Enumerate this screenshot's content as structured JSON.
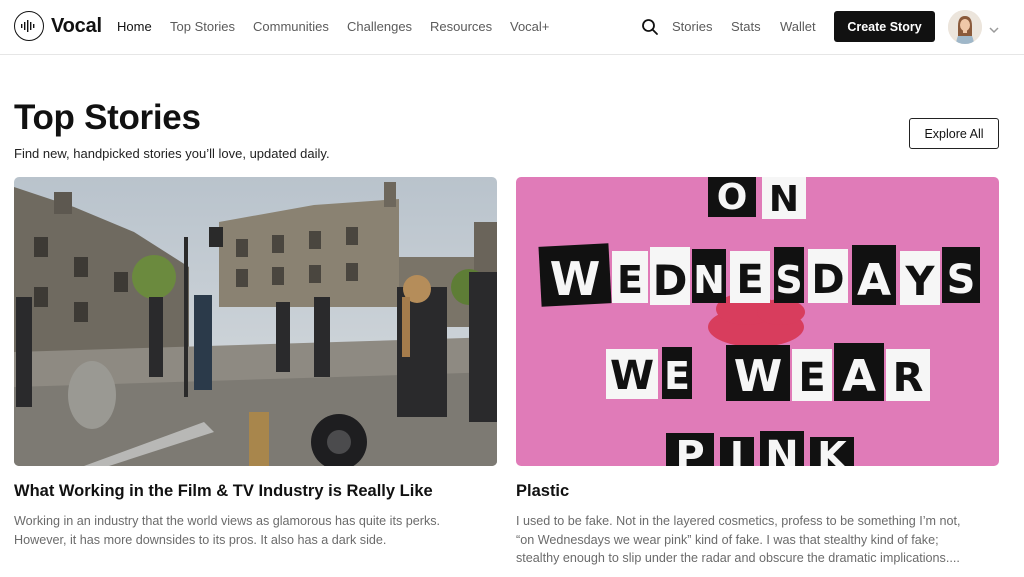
{
  "brand": {
    "name": "Vocal",
    "icon": "soundwave-circle-icon"
  },
  "nav": {
    "links": [
      {
        "label": "Home",
        "active": true
      },
      {
        "label": "Top Stories",
        "active": false
      },
      {
        "label": "Communities",
        "active": false
      },
      {
        "label": "Challenges",
        "active": false
      },
      {
        "label": "Resources",
        "active": false
      },
      {
        "label": "Vocal+",
        "active": false
      }
    ],
    "search_icon": "search-icon",
    "right_links": [
      {
        "label": "Stories"
      },
      {
        "label": "Stats"
      },
      {
        "label": "Wallet"
      }
    ],
    "create_label": "Create Story",
    "avatar_icon": "avatar",
    "menu_icon": "chevron-down-icon"
  },
  "header": {
    "title": "Top Stories",
    "subtitle": "Find new, handpicked stories you’ll love, updated daily.",
    "explore_label": "Explore All"
  },
  "stories": [
    {
      "title": "What Working in the Film & TV Industry is Really Like",
      "excerpt_lines": [
        "Working in an industry that the world views as glamorous has quite its perks.",
        "However, it has more downsides to its pros. It also has a dark side."
      ]
    },
    {
      "title": "Plastic",
      "excerpt_lines": [
        "I used to be fake. Not in the layered cosmetics, profess to be something I’m not,",
        "“on Wednesdays we wear pink” kind of fake. I was that stealthy kind of fake;",
        "stealthy enough to slip under the radar and obscure the dramatic implications...."
      ],
      "image_text": {
        "row1": [
          "O",
          "N"
        ],
        "row2": [
          "W",
          "E",
          "D",
          "N",
          "E",
          "S",
          "D",
          "A",
          "Y",
          "S"
        ],
        "row3": [
          "W",
          "E",
          "W",
          "E",
          "A",
          "R"
        ],
        "row4": [
          "P",
          "I",
          "N",
          "K"
        ]
      }
    }
  ],
  "colors": {
    "accent": "#111111",
    "pink_bg": "#e07bb8",
    "muted_text": "#6b6b6b"
  }
}
